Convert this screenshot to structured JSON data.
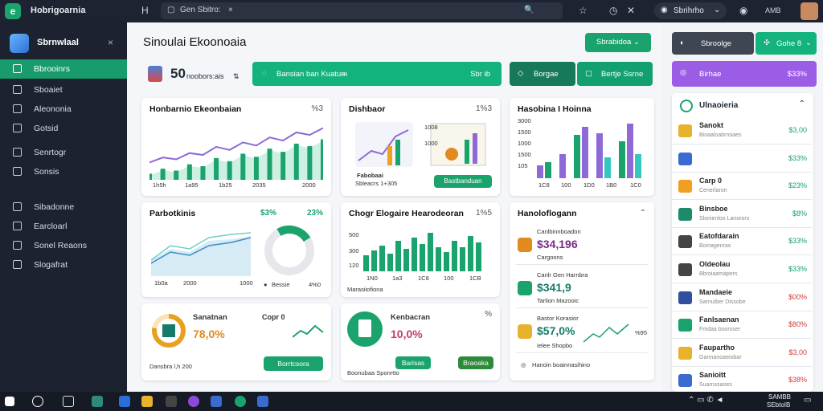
{
  "app": {
    "title": "Hobrigoarnia",
    "search": "Gen Sbitro:",
    "account": "Sbrihrho",
    "user": "AMB"
  },
  "sidebar": {
    "brand": "Sbrnwlaal",
    "items": [
      "Bbrooinrs",
      "Sboaiet",
      "Aleononia",
      "Gotsid",
      "Senrtogr",
      "Sonsis",
      "Sibadonne",
      "Earcloarl",
      "Sonel Reaons",
      "Slogafrat"
    ]
  },
  "header": {
    "title": "Sinoulai Ekoonoaia",
    "dropdown": "Sbrabidoa",
    "metric": "50",
    "metric_label": "noobors:ais",
    "filter": "Bansian ban Kuatum",
    "filter_right": "Sbr ib",
    "btn1": "Borgae",
    "btn2": "Bertje Ssrne"
  },
  "cards": {
    "c1": {
      "title": "Honbarnio Ekeonbaian",
      "icon": "%3",
      "ticks": [
        "1h5h",
        "1a95",
        "1b25",
        "2035",
        "2000"
      ]
    },
    "c2": {
      "title": "Dishbaor",
      "icon": "1%3",
      "ticks": [
        "1008",
        "1000"
      ],
      "caption": "Fabobaai",
      "caption2": "Sbleacrs 1+305",
      "button": "Bastbanduan"
    },
    "c3": {
      "title": "Hasobina I Hoinna",
      "yticks": [
        "3000",
        "1500",
        "1000",
        "1500",
        "105"
      ],
      "xticks": [
        "1C8",
        "100",
        "1D0",
        "1B0",
        "1C0"
      ]
    },
    "c4": {
      "title": "Parbotkinis",
      "pct1": "$3%",
      "pct2": "23%",
      "ticks": [
        "1b0a",
        "2000",
        "1000"
      ],
      "legend": "Bessie",
      "legend2": "4%0"
    },
    "c5": {
      "title": "Chogr Elogaire Hearodeoran",
      "icon": "1%5",
      "yticks": [
        "500",
        "300",
        "120"
      ],
      "xticks": [
        "1N0",
        "1a3",
        "1C8",
        "100",
        "1CB"
      ],
      "caption": "Marasiiofiona"
    },
    "c6": {
      "title": "Hanoloflogann",
      "items": [
        {
          "value": "$34,196",
          "sub": "Cargoons",
          "title": "Canlbinnboadon"
        },
        {
          "value": "$341,9",
          "sub": "Tarlion Mazooic",
          "title": "Canlr Gen Harnbra"
        },
        {
          "value": "$57,0%",
          "sub": "Ielee Shopbo",
          "title": "Bastor Korasior"
        }
      ],
      "footer": "Hanoin boainnasihino",
      "tick": "%95"
    },
    "c7": {
      "title": "Sanatnan",
      "pct": "78,0%",
      "sub": "Dansbra l,h 200",
      "title2": "Copr 0",
      "button": "Borrtcsora"
    },
    "c8": {
      "title": "Kenbacran",
      "pct": "10,0%",
      "sub": "Boonubaa Sponrtto",
      "btn1": "Barisas",
      "btn2": "Braoaka"
    }
  },
  "right": {
    "top_btn1": "Sbroolge",
    "top_btn2": "Gohe 8",
    "purple": "Birhae",
    "purple_val": "$33%",
    "panel_title": "Ulnaoieria",
    "rows": [
      {
        "t": "Sanokt",
        "s": "Bioaaloabrroiaes",
        "v": "$3,00",
        "c": "#1aa36d",
        "ic": "#e8b22c"
      },
      {
        "t": "",
        "s": "",
        "v": "$33%",
        "c": "#1aa36d",
        "ic": "#3b6bd0"
      },
      {
        "t": "Carp 0",
        "s": "Cenerlaron",
        "v": "$23%",
        "c": "#1aa36d",
        "ic": "#f0a020"
      },
      {
        "t": "Binsboe",
        "s": "Slonienloo Lanorors",
        "v": "$8%",
        "c": "#1aa36d",
        "ic": "#1c8b6a"
      },
      {
        "t": "Eatofdarain",
        "s": "Boinagenras",
        "v": "$33%",
        "c": "#1aa36d",
        "ic": "#444"
      },
      {
        "t": "Oldeolau",
        "s": "Bbroiaamapers",
        "v": "$33%",
        "c": "#1aa36d",
        "ic": "#444"
      },
      {
        "t": "Mandaeie",
        "s": "Sarnuiber Dissobe",
        "v": "$00%",
        "c": "#d23b3b",
        "ic": "#2f4fa0"
      },
      {
        "t": "Fanlsaenan",
        "s": "Fmdaa booroser",
        "v": "$80%",
        "c": "#d23b3b",
        "ic": "#1aa36d"
      },
      {
        "t": "Faupartho",
        "s": "Garmanoaeiobar",
        "v": "$3,00",
        "c": "#d23b3b",
        "ic": "#e8b22c"
      },
      {
        "t": "Sanioitt",
        "s": "Suarnssaoes",
        "v": "$38%",
        "c": "#d23b3b",
        "ic": "#3b6bd0"
      }
    ]
  },
  "taskbar": {
    "time": "SAMBB",
    "date": "SEbtoIB"
  },
  "chart_data": {
    "type": "line",
    "series": [
      {
        "name": "",
        "values": [
          20,
          28,
          25,
          35,
          32,
          45,
          40,
          52,
          47,
          60,
          55,
          68,
          64,
          75
        ]
      }
    ]
  }
}
